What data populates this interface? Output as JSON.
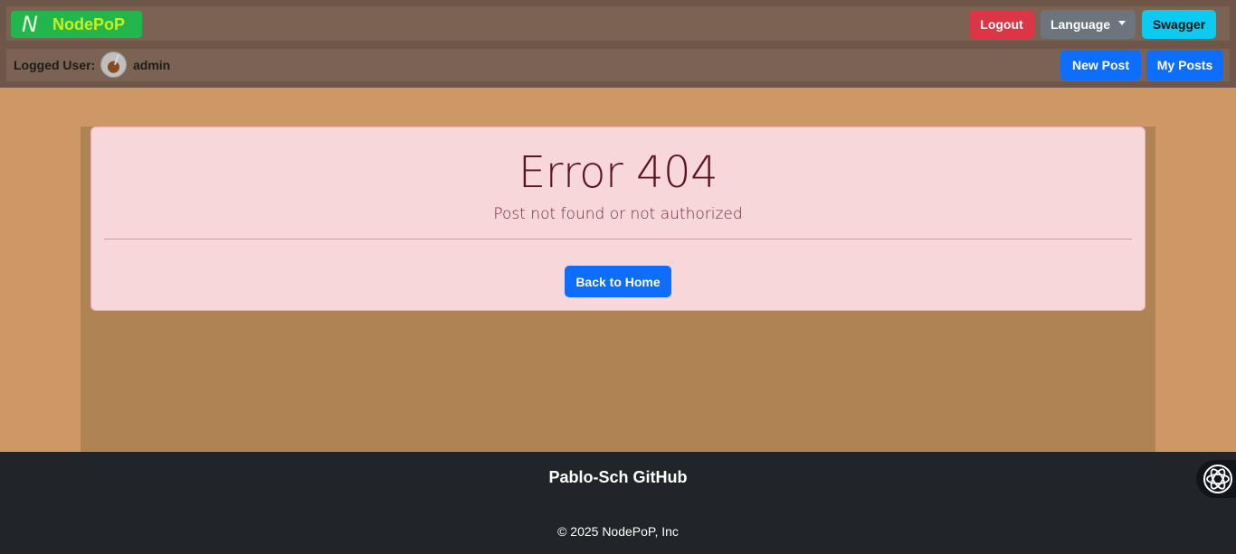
{
  "brand": {
    "logo_letter": "N",
    "name": "NodePoP"
  },
  "header": {
    "logout_label": "Logout",
    "language_label": "Language",
    "swagger_label": "Swagger",
    "logged_user_label": "Logged User:",
    "username": "admin",
    "new_post_label": "New Post",
    "my_posts_label": "My Posts"
  },
  "error": {
    "title": "Error 404",
    "message": "Post not found or not authorized",
    "back_label": "Back to Home"
  },
  "footer": {
    "link_label": "Pablo-Sch GitHub",
    "copyright": "© 2025 NodePoP, Inc"
  },
  "colors": {
    "page_bg": "#cd9766",
    "header_bg": "#6e5648",
    "brand_green": "#22b64d",
    "danger": "#dc3545",
    "secondary": "#6c757d",
    "info": "#0dcaf0",
    "primary": "#0d6efd",
    "alert_bg": "#f8d7da",
    "footer_bg": "#212529"
  },
  "icons": {
    "language_caret": "caret-down-icon",
    "floating": "assistant-icon"
  }
}
